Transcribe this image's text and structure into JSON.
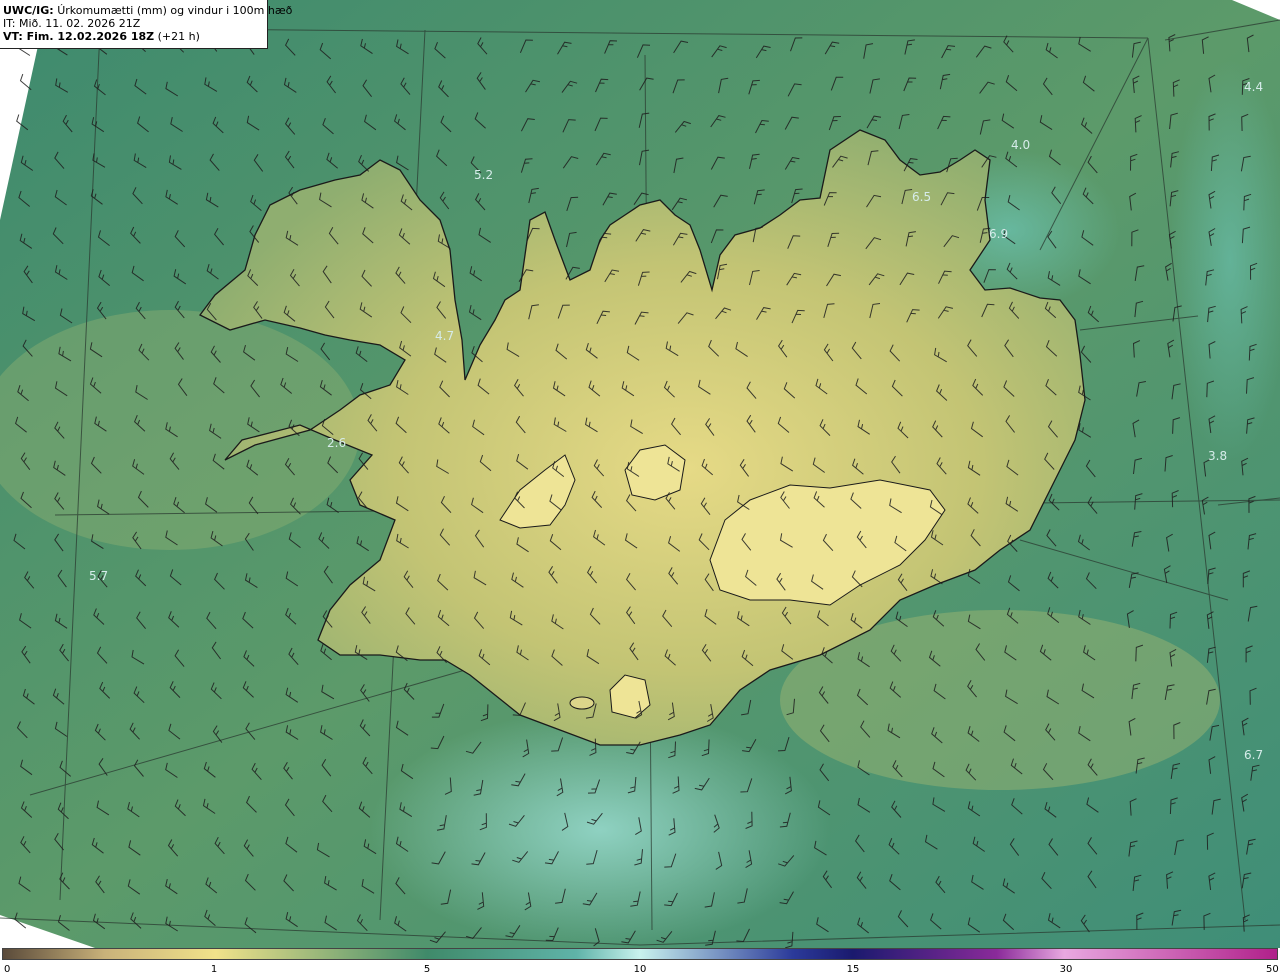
{
  "header": {
    "product": "UWC/IG:",
    "description": "Úrkomumætti (mm) og vindur i 100m hæð",
    "issue_time": "IT: Mið. 11. 02. 2026 21Z",
    "valid_prefix": "VT: Fim. 12.02.2026 18Z",
    "valid_suffix": "(+21 h)"
  },
  "map_values": [
    {
      "text": "5.2"
    },
    {
      "text": "4.0"
    },
    {
      "text": "4.4"
    },
    {
      "text": "6.5"
    },
    {
      "text": "6.9"
    },
    {
      "text": "4.7"
    },
    {
      "text": "2.6"
    },
    {
      "text": "5.7"
    },
    {
      "text": "3.8"
    },
    {
      "text": "6.7"
    }
  ],
  "colorbar": {
    "ticks": [
      "0",
      "1",
      "5",
      "10",
      "15",
      "30",
      "50"
    ],
    "colors": {
      "low": "#5a4a3a",
      "tan": "#c9b27a",
      "yellow": "#f0e28a",
      "green": "#3f8a6a",
      "teal": "#5fb3a8",
      "cyan": "#c9f2ee",
      "blue": "#2b3a9a",
      "navy": "#1a1a6e",
      "purple": "#8a2a9a",
      "pink": "#e8a8e0",
      "magenta": "#b0208a"
    }
  }
}
